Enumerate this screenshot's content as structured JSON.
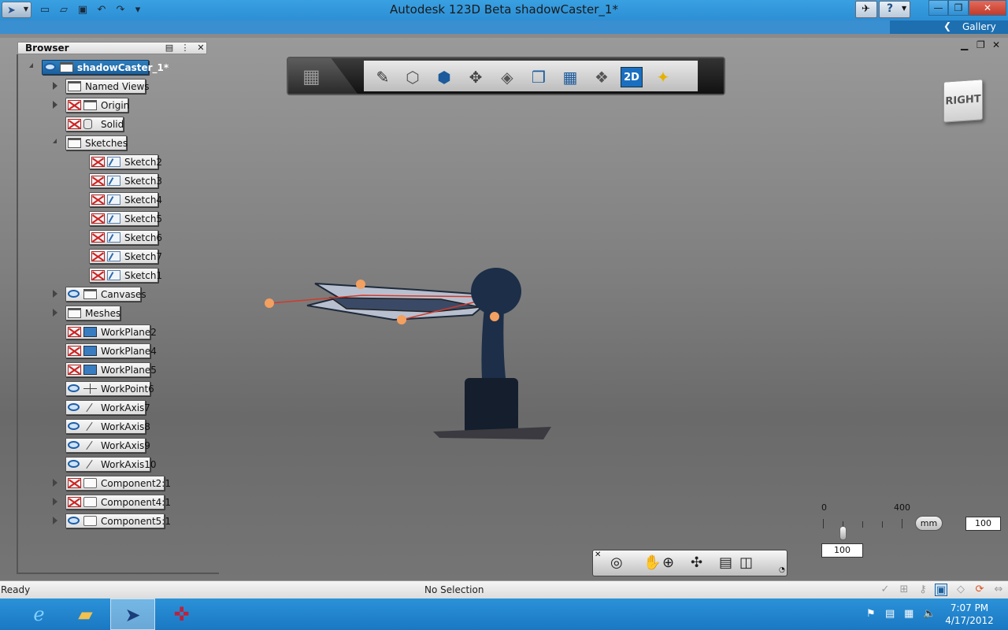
{
  "window": {
    "title": "Autodesk 123D Beta    shadowCaster_1*",
    "gallery_label": "Gallery"
  },
  "browser": {
    "title": "Browser",
    "tree": [
      {
        "label": "shadowCaster_1*",
        "icon": "eye-icon",
        "selected": true
      },
      {
        "label": "Named Views",
        "icon": "folder-icon"
      },
      {
        "label": "Origin",
        "icon": "hidden-icon"
      },
      {
        "label": "Solid",
        "icon": "hidden-icon"
      },
      {
        "label": "Sketches",
        "icon": "folder-icon"
      },
      {
        "label": "Sketch2",
        "icon": "hidden-icon"
      },
      {
        "label": "Sketch3",
        "icon": "hidden-icon"
      },
      {
        "label": "Sketch4",
        "icon": "hidden-icon"
      },
      {
        "label": "Sketch5",
        "icon": "hidden-icon"
      },
      {
        "label": "Sketch6",
        "icon": "hidden-icon"
      },
      {
        "label": "Sketch7",
        "icon": "hidden-icon"
      },
      {
        "label": "Sketch1",
        "icon": "hidden-icon"
      },
      {
        "label": "Canvases",
        "icon": "eye-icon"
      },
      {
        "label": "Meshes",
        "icon": "folder-icon"
      },
      {
        "label": "WorkPlane2",
        "icon": "hidden-icon"
      },
      {
        "label": "WorkPlane4",
        "icon": "hidden-icon"
      },
      {
        "label": "WorkPlane5",
        "icon": "hidden-icon"
      },
      {
        "label": "WorkPoint6",
        "icon": "eye-icon"
      },
      {
        "label": "WorkAxis7",
        "icon": "eye-icon"
      },
      {
        "label": "WorkAxis8",
        "icon": "eye-icon"
      },
      {
        "label": "WorkAxis9",
        "icon": "eye-icon"
      },
      {
        "label": "WorkAxis10",
        "icon": "eye-icon"
      },
      {
        "label": "Component2:1",
        "icon": "hidden-icon"
      },
      {
        "label": "Component4:1",
        "icon": "hidden-icon"
      },
      {
        "label": "Component5:1",
        "icon": "eye-icon"
      }
    ]
  },
  "viewcube": {
    "face": "RIGHT"
  },
  "scale": {
    "min": "0",
    "max": "400",
    "unit": "mm",
    "value_right": "100",
    "value_bottom": "100"
  },
  "status": {
    "left": "Ready",
    "center": "No Selection"
  },
  "clock": {
    "time": "7:07 PM",
    "date": "4/17/2012"
  },
  "colors": {
    "accent": "#2d8fd4",
    "selection": "#1b5f9a",
    "hidden_mark": "#d02020",
    "model": "#1c2e48",
    "workpoint": "#f4a060"
  }
}
